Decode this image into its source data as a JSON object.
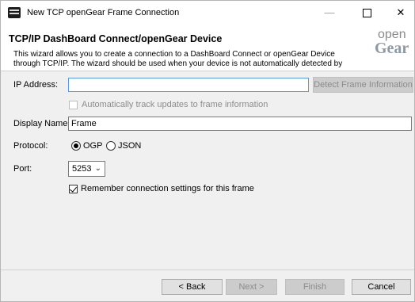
{
  "window": {
    "title": "New TCP openGear Frame Connection",
    "minimize_glyph": "—",
    "close_glyph": "✕"
  },
  "header": {
    "title": "TCP/IP DashBoard Connect/openGear Device",
    "description": "This wizard allows you to create a connection to a DashBoard Connect or openGear Device through TCP/IP.  The wizard should be used when your device is not automatically detected by",
    "logo_line1": "open",
    "logo_line2": "Gear"
  },
  "form": {
    "ip_label": "IP Address:",
    "ip_value": "",
    "detect_button": "Detect Frame Information",
    "auto_track_label": "Automatically track updates to frame information",
    "auto_track_checked": false,
    "display_name_label": "Display Name:",
    "display_name_value": "Frame",
    "protocol_label": "Protocol:",
    "protocol_options": [
      {
        "label": "OGP",
        "selected": true
      },
      {
        "label": "JSON",
        "selected": false
      }
    ],
    "port_label": "Port:",
    "port_value": "5253",
    "remember_label": "Remember connection settings for this frame",
    "remember_checked": true
  },
  "footer": {
    "back": "< Back",
    "next": "Next >",
    "finish": "Finish",
    "cancel": "Cancel"
  },
  "colors": {
    "focus_border": "#569de5",
    "disabled_text": "#8c8c8c",
    "logo": "#8d9aa6"
  },
  "icons": {
    "app": "opengear-frame-icon",
    "dropdown": "chevron-down-icon"
  }
}
